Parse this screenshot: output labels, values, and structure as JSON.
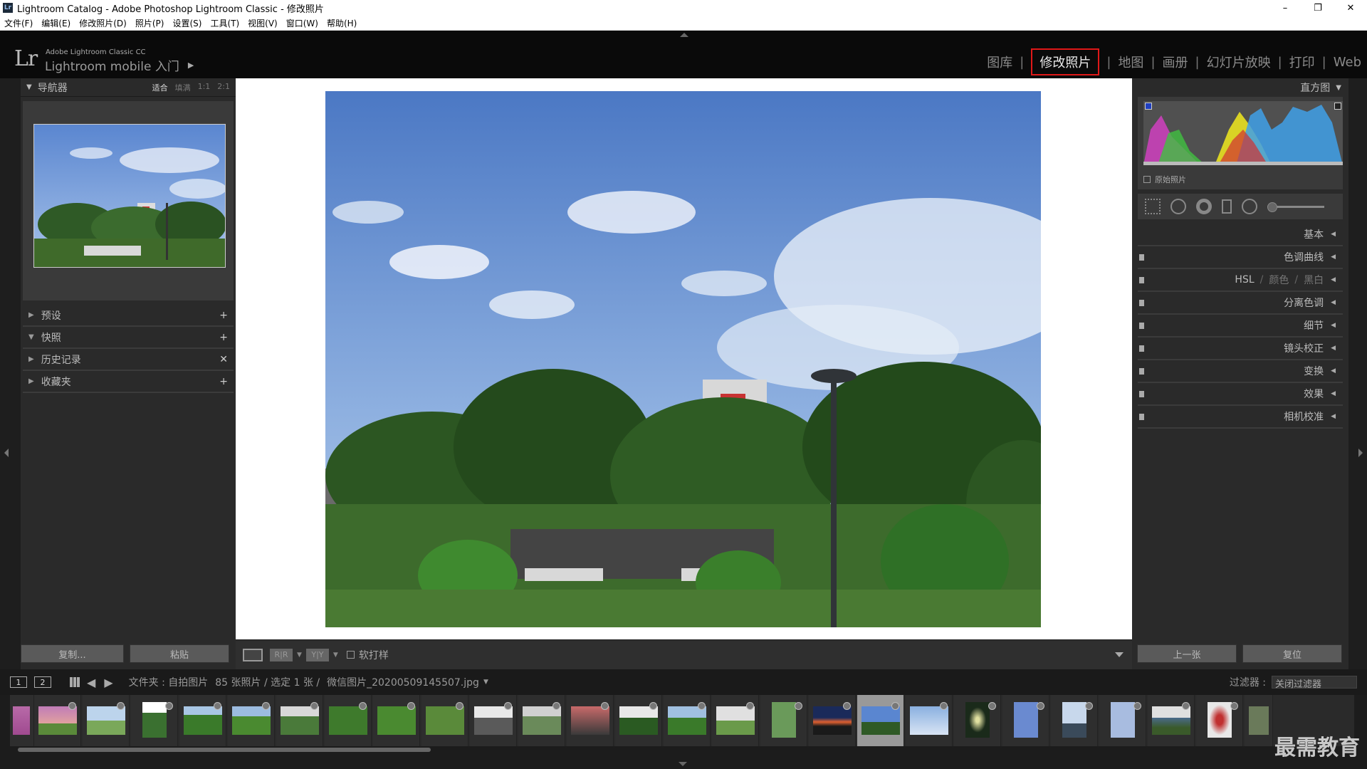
{
  "window": {
    "title": "Lightroom Catalog - Adobe Photoshop Lightroom Classic - 修改照片",
    "controls": [
      "–",
      "❐",
      "✕"
    ]
  },
  "menu": [
    "文件(F)",
    "编辑(E)",
    "修改照片(D)",
    "照片(P)",
    "设置(S)",
    "工具(T)",
    "视图(V)",
    "窗口(W)",
    "帮助(H)"
  ],
  "identity": {
    "product_small": "Adobe Lightroom Classic CC",
    "product_main": "Lightroom mobile 入门"
  },
  "modules": [
    "图库",
    "修改照片",
    "地图",
    "画册",
    "幻灯片放映",
    "打印",
    "Web"
  ],
  "active_module": "修改照片",
  "navigator": {
    "title": "导航器",
    "zoom": [
      "适合",
      "填满",
      "1:1",
      "2:1"
    ]
  },
  "left_panels": [
    {
      "label": "预设",
      "action": "+"
    },
    {
      "label": "快照",
      "action": "+"
    },
    {
      "label": "历史记录",
      "action": "✕"
    },
    {
      "label": "收藏夹",
      "action": "+"
    }
  ],
  "left_buttons": {
    "copy": "复制...",
    "paste": "粘贴"
  },
  "toolbar": {
    "soft_proof": "软打样"
  },
  "histogram": {
    "title": "直方图",
    "original": "原始照片"
  },
  "right_panels": [
    "基本",
    "色调曲线",
    "分离色调",
    "细节",
    "镜头校正",
    "变换",
    "效果",
    "相机校准"
  ],
  "hsl": {
    "a": "HSL",
    "b": "颜色",
    "c": "黑白"
  },
  "right_buttons": {
    "prev": "上一张",
    "reset": "复位"
  },
  "filmbar": {
    "page1": "1",
    "page2": "2",
    "folder": "文件夹 : 自拍图片",
    "count": "85 张照片 / 选定 1 张 /",
    "filename": "微信图片_20200509145507.jpg",
    "filter_label": "过滤器 :",
    "filter_value": "关闭过滤器"
  },
  "watermark": "最需教育"
}
